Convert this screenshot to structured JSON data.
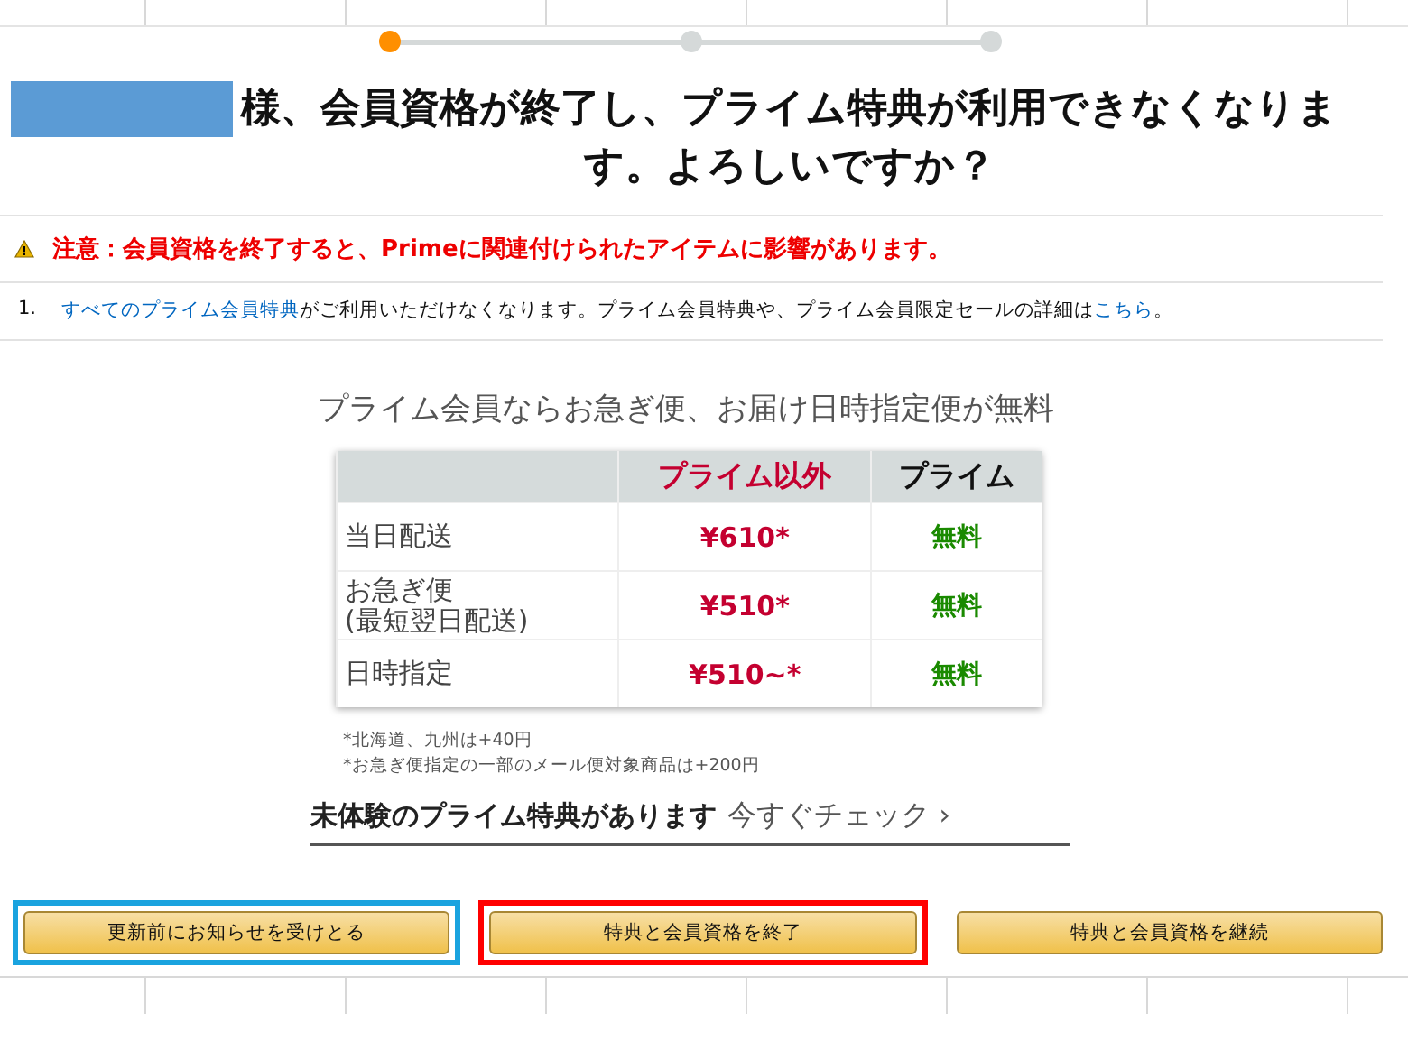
{
  "steps": [
    {
      "selected": true
    },
    {
      "selected": false
    },
    {
      "selected": false
    }
  ],
  "title": {
    "name_redacted": true,
    "text": "様、会員資格が終了し、プライム特典が利用できなくなります。よろしいですか？"
  },
  "warning": "注意：会員資格を終了すると、Primeに関連付けられたアイテムに影響があります。",
  "notes_list": [
    {
      "number": "1.",
      "link": "すべてのプライム会員特典",
      "text": "がご利用いただけなくなります。プライム会員特典や、プライム会員限定セールの詳細は",
      "link2": "こちら",
      "end": "。"
    }
  ],
  "promo_heading": "プライム会員ならお急ぎ便、お届け日時指定便が無料",
  "table": {
    "columns": [
      "プライム以外",
      "プライム"
    ],
    "rows": [
      {
        "label": "当日配送",
        "price": "¥610*",
        "prime": "無料"
      },
      {
        "label": "お急ぎ便\n(最短翌日配送)",
        "price": "¥510*",
        "prime": "無料"
      },
      {
        "label": "日時指定",
        "price": "¥510~*",
        "prime": "無料"
      }
    ]
  },
  "footnotes": [
    "*北海道、九州は+40円",
    "*お急ぎ便指定の一部のメール便対象商品は+200円"
  ],
  "check_link": {
    "label": "未体験のプライム特典があります",
    "action": "今すぐチェック ›"
  },
  "buttons": [
    {
      "label": "更新前にお知らせを受けとる",
      "focused": true,
      "highlighted": false
    },
    {
      "label": "特典と会員資格を終了",
      "focused": false,
      "highlighted": true
    },
    {
      "label": "特典と会員資格を継続",
      "focused": false,
      "highlighted": false
    }
  ]
}
